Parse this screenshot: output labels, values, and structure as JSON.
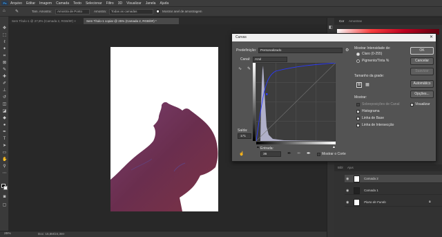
{
  "menu": {
    "logo": "Ps",
    "items": [
      "Arquivo",
      "Editar",
      "Imagem",
      "Camada",
      "Texto",
      "Selecionar",
      "Filtro",
      "3D",
      "Visualizar",
      "Janela",
      "Ajuda"
    ]
  },
  "options_bar": {
    "size_label": "Tam. Amostra:",
    "size_value": "Amostra de Ponto",
    "sample_label": "Amostra:",
    "sample_value": "Todas as camadas",
    "ring_label": "Mostrar anel de amostragem"
  },
  "tabs": [
    {
      "label": "Sem Título-1 @ 27,8% (Camada 2, RGB/8#) ×",
      "active": false
    },
    {
      "label": "Sem Título-1 copiar @ 25% (Camada 2, RGB/8#) *",
      "active": true
    }
  ],
  "status": {
    "zoom": "25%",
    "doc": "Doc: 15,8M/24,3M"
  },
  "right_panels": {
    "tabs_top": [
      "Cor",
      "Amostras"
    ],
    "layer_tabs": [
      "Bibl",
      "Ajus"
    ],
    "layers": [
      {
        "name": "Camada 2",
        "selected": true
      },
      {
        "name": "Camada 1",
        "selected": false
      },
      {
        "name": "Plano de Fundo",
        "selected": false
      }
    ]
  },
  "curves": {
    "title": "Curvas",
    "preset_label": "Predefinição:",
    "preset_value": "Personalizado",
    "channel_label": "Canal:",
    "channel_value": "Azul",
    "output_label": "Saída:",
    "output_value": "171",
    "input_label": "Entrada:",
    "input_value": "36",
    "show_clipping": "Mostrar o Corte",
    "show_amount_title": "Mostrar Intensidade de:",
    "light_option": "Claro (0-255)",
    "pigment_option": "Pigmento/Tinta %",
    "grid_size": "Tamanho da grade:",
    "show_title": "Mostrar:",
    "show_options": [
      {
        "label": "Sobreposições de Canal",
        "checked": false
      },
      {
        "label": "Histograma",
        "checked": true
      },
      {
        "label": "Linha de Base",
        "checked": true
      },
      {
        "label": "Linha de Intersecção",
        "checked": true
      }
    ],
    "buttons": {
      "ok": "OK",
      "cancel": "Cancelar",
      "smooth": "Suavizar",
      "auto": "Automático",
      "options": "Opções..."
    },
    "preview_label": "Visualizar",
    "preview_checked": true
  }
}
